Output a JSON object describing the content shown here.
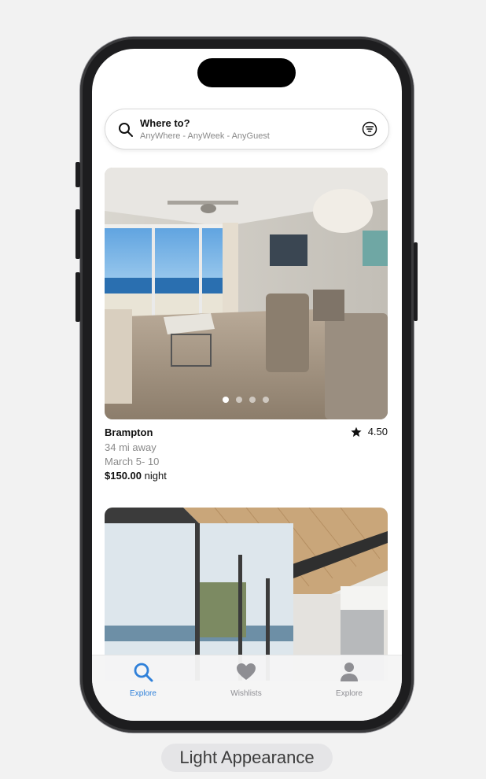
{
  "search": {
    "title": "Where to?",
    "subtitle": "AnyWhere - AnyWeek - AnyGuest",
    "icon": "search-icon",
    "filter_icon": "filter-icon"
  },
  "listings": [
    {
      "city": "Brampton",
      "rating": "4.50",
      "distance": "34 mi away",
      "dates": "March 5- 10",
      "price": "$150.00",
      "price_unit": "night",
      "photo_count": 4,
      "active_photo": 1
    }
  ],
  "tabbar": {
    "items": [
      {
        "label": "Explore",
        "icon": "magnifying-glass-icon",
        "active": true
      },
      {
        "label": "Wishlists",
        "icon": "heart-icon",
        "active": false
      },
      {
        "label": "Explore",
        "icon": "person-icon",
        "active": false
      }
    ]
  },
  "caption": "Light Appearance",
  "colors": {
    "accent": "#2f80d9",
    "muted": "#8e8e93"
  }
}
